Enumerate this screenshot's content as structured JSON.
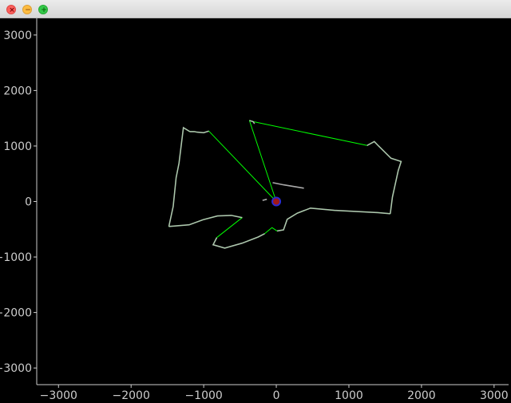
{
  "window": {
    "controls": {
      "close_symbol": "×",
      "minimize_symbol": "−",
      "maximize_symbol": "+"
    }
  },
  "colors": {
    "background": "#000000",
    "axis": "#cccccc",
    "label": "#cccccc",
    "laser": "#00ff00",
    "wall": "#c8c8c8",
    "robot_fill": "#a01818",
    "robot_edge": "#2b2bd0"
  },
  "chart_data": {
    "type": "scatter",
    "title": "",
    "xlabel": "",
    "ylabel": "",
    "xlim": [
      -3300,
      3200
    ],
    "ylim": [
      -3300,
      3300
    ],
    "x_ticks": [
      -3000,
      -2000,
      -1000,
      0,
      1000,
      2000,
      3000
    ],
    "y_ticks": [
      3000,
      2000,
      1000,
      0,
      -1000,
      -2000,
      -3000
    ],
    "x_tick_labels": [
      "−3000",
      "−2000",
      "−1000",
      "0",
      "1000",
      "2000",
      "3000"
    ],
    "y_tick_labels": [
      "3000",
      "2000",
      "1000",
      "0",
      "−1000",
      "−2000",
      "−3000"
    ],
    "grid": false,
    "robot": {
      "x": 0,
      "y": 0
    },
    "series": [
      {
        "values": [
          [
            0,
            0
          ],
          [
            -930,
            1270
          ],
          [
            -1000,
            1240
          ],
          [
            -1090,
            1250
          ],
          [
            -1130,
            1260
          ],
          [
            -1190,
            1260
          ],
          [
            -1280,
            1330
          ],
          [
            -1340,
            690
          ],
          [
            -1380,
            430
          ],
          [
            -1420,
            -90
          ],
          [
            -1480,
            -450
          ],
          [
            -1200,
            -420
          ],
          [
            -1010,
            -330
          ],
          [
            -810,
            -260
          ],
          [
            -620,
            -250
          ],
          [
            -470,
            -290
          ],
          [
            -820,
            -650
          ],
          [
            -870,
            -780
          ],
          [
            -710,
            -840
          ],
          [
            -470,
            -750
          ],
          [
            -250,
            -640
          ],
          [
            -160,
            -580
          ],
          [
            -60,
            -470
          ],
          [
            10,
            -530
          ],
          [
            100,
            -510
          ],
          [
            150,
            -320
          ],
          [
            290,
            -210
          ],
          [
            470,
            -120
          ],
          [
            800,
            -160
          ],
          [
            1400,
            -200
          ],
          [
            1570,
            -220
          ],
          [
            1600,
            80
          ],
          [
            1680,
            560
          ],
          [
            1720,
            720
          ],
          [
            1580,
            780
          ],
          [
            1410,
            1000
          ],
          [
            1350,
            1080
          ],
          [
            1250,
            1010
          ],
          [
            -320,
            1440
          ],
          [
            -370,
            1460
          ]
        ]
      }
    ],
    "walls": [
      [
        [
          -930,
          1270
        ],
        [
          -1000,
          1240
        ],
        [
          -1090,
          1250
        ],
        [
          -1130,
          1260
        ],
        [
          -1190,
          1260
        ]
      ],
      [
        [
          -1190,
          1260
        ],
        [
          -1280,
          1330
        ],
        [
          -1340,
          690
        ],
        [
          -1380,
          430
        ],
        [
          -1420,
          -90
        ],
        [
          -1480,
          -450
        ]
      ],
      [
        [
          -1480,
          -450
        ],
        [
          -1200,
          -420
        ],
        [
          -1010,
          -330
        ],
        [
          -810,
          -260
        ],
        [
          -620,
          -250
        ],
        [
          -470,
          -290
        ]
      ],
      [
        [
          -820,
          -650
        ],
        [
          -870,
          -780
        ],
        [
          -710,
          -840
        ],
        [
          -470,
          -750
        ],
        [
          -250,
          -640
        ],
        [
          -160,
          -580
        ]
      ],
      [
        [
          10,
          -530
        ],
        [
          100,
          -510
        ],
        [
          150,
          -320
        ],
        [
          290,
          -210
        ],
        [
          470,
          -120
        ],
        [
          800,
          -160
        ],
        [
          1400,
          -200
        ],
        [
          1570,
          -220
        ]
      ],
      [
        [
          1570,
          -220
        ],
        [
          1600,
          80
        ],
        [
          1680,
          560
        ],
        [
          1720,
          720
        ],
        [
          1580,
          780
        ],
        [
          1410,
          1000
        ],
        [
          1350,
          1080
        ],
        [
          1250,
          1010
        ]
      ],
      [
        [
          -370,
          1460
        ],
        [
          -320,
          1440
        ],
        [
          -300,
          1400
        ]
      ],
      [
        [
          -50,
          340
        ],
        [
          100,
          300
        ],
        [
          380,
          240
        ]
      ],
      [
        [
          -130,
          40
        ],
        [
          -190,
          20
        ]
      ]
    ]
  }
}
